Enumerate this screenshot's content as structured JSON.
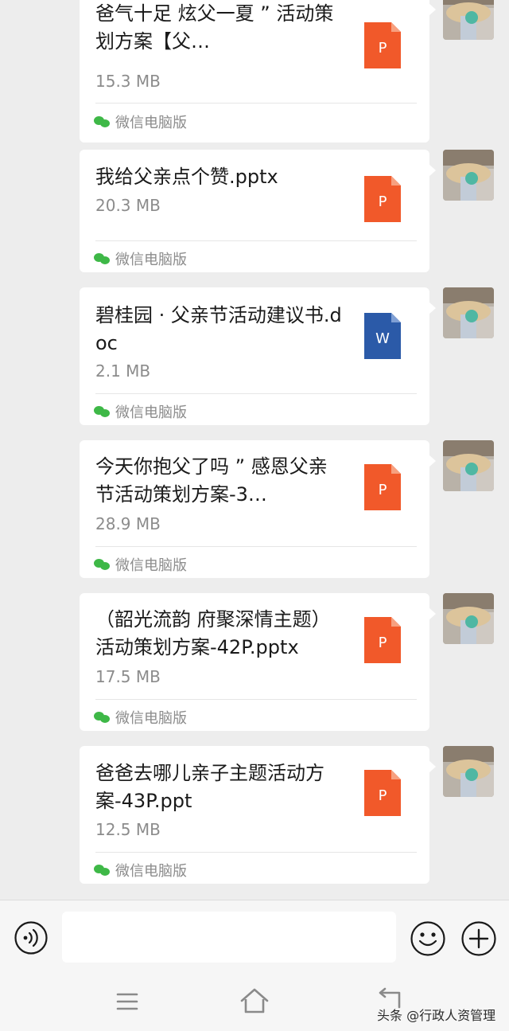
{
  "messages": [
    {
      "filename": "爸气十足 炫父一夏 ” 活动策划方案【父…",
      "size": "15.3 MB",
      "source": "微信电脑版",
      "icon": "ppt-file-icon",
      "letter": "P",
      "color": "#f1592a"
    },
    {
      "filename": "我给父亲点个赞.pptx",
      "size": "20.3 MB",
      "source": "微信电脑版",
      "icon": "ppt-file-icon",
      "letter": "P",
      "color": "#f1592a"
    },
    {
      "filename": "碧桂园 · 父亲节活动建议书.doc",
      "size": "2.1 MB",
      "source": "微信电脑版",
      "icon": "word-file-icon",
      "letter": "W",
      "color": "#2b5aa8"
    },
    {
      "filename": "今天你抱父了吗 ” 感恩父亲节活动策划方案-3…",
      "size": "28.9 MB",
      "source": "微信电脑版",
      "icon": "ppt-file-icon",
      "letter": "P",
      "color": "#f1592a"
    },
    {
      "filename": "（韶光流韵 府聚深情主题）活动策划方案-42P.pptx",
      "size": "17.5 MB",
      "source": "微信电脑版",
      "icon": "ppt-file-icon",
      "letter": "P",
      "color": "#f1592a"
    },
    {
      "filename": "爸爸去哪儿亲子主题活动方案-43P.ppt",
      "size": "12.5 MB",
      "source": "微信电脑版",
      "icon": "ppt-file-icon",
      "letter": "P",
      "color": "#f1592a"
    }
  ],
  "input": {
    "placeholder": ""
  },
  "icons": {
    "voice": "voice-icon",
    "emoji": "emoji-icon",
    "plus": "plus-icon",
    "menu": "menu-icon",
    "home": "home-icon",
    "back": "back-icon",
    "source": "wechat-icon"
  },
  "watermark": "头条 @行政人资管理",
  "colors": {
    "background": "#ededed",
    "bubble": "#ffffff",
    "wechat_green": "#3eb847",
    "ppt_orange": "#f1592a",
    "word_blue": "#2b5aa8"
  }
}
